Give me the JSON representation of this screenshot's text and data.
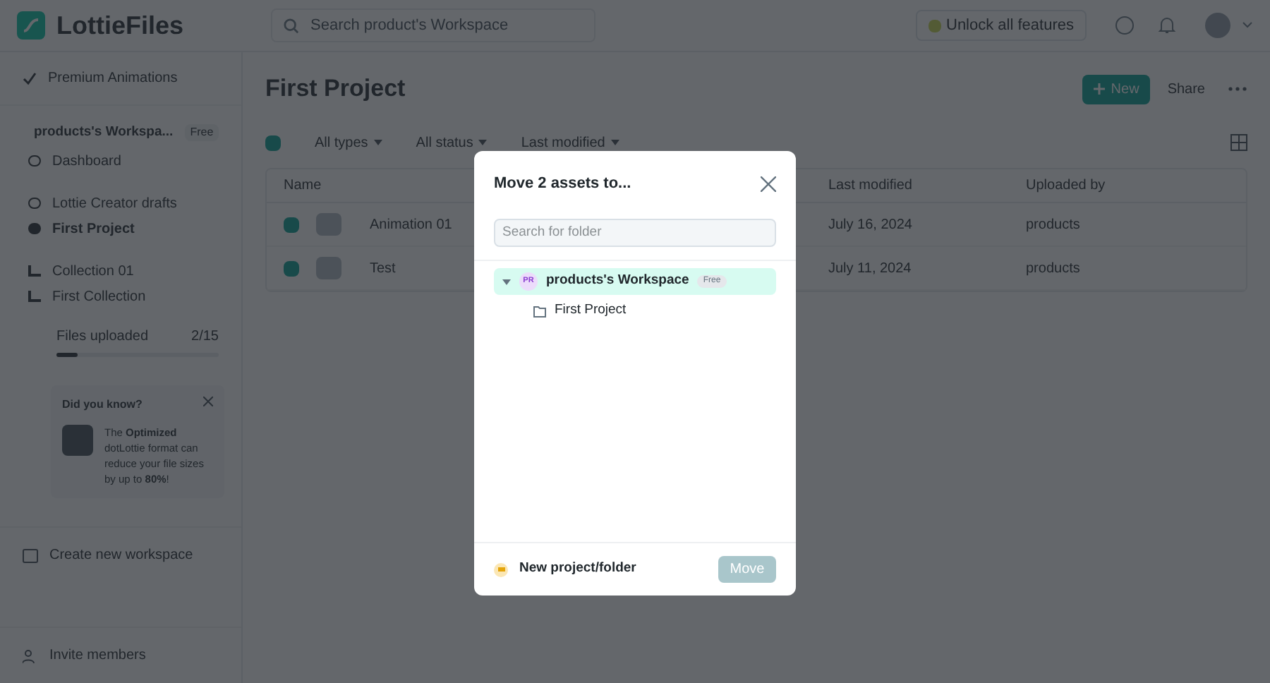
{
  "header": {
    "logo": "LottieFiles",
    "search_placeholder": "Search product's Workspace",
    "unlock_button": "Unlock all features"
  },
  "sidebar": {
    "premium": "Premium Animations",
    "workspace": {
      "name": "products's Workspa...",
      "badge": "Free"
    },
    "items": [
      {
        "label": "Dashboard",
        "kind": "dashboard",
        "selected": false
      },
      {
        "label": "Lottie Creator drafts",
        "kind": "drafts",
        "selected": false
      },
      {
        "label": "First Project",
        "kind": "project",
        "selected": true
      },
      {
        "label": "Collection 01",
        "kind": "collection",
        "selected": false
      },
      {
        "label": "First Collection",
        "kind": "collection",
        "selected": false
      }
    ],
    "files": {
      "label": "Files uploaded",
      "count": "2/15",
      "level": 0.13
    },
    "tip": {
      "title": "Did you know?",
      "text": "The **Optimized** dotLottie format can reduce your file sizes by up to **80%**!"
    },
    "create_workspace": "Create new workspace",
    "invite": "Invite members"
  },
  "main": {
    "title": "First Project",
    "new_button": "New",
    "share_button": "Share",
    "select_all": {
      "checked": true
    },
    "filters": [
      "All types",
      "All status",
      "Last modified"
    ],
    "columns": [
      "Name",
      "Last modified",
      "Uploaded by"
    ],
    "rows": [
      {
        "checked": true,
        "name": "Animation 01",
        "modified": "July 16, 2024",
        "uploaded_by": "products"
      },
      {
        "checked": true,
        "name": "Test",
        "modified": "July 11, 2024",
        "uploaded_by": "products"
      }
    ]
  },
  "modal": {
    "title": "Move 2 assets to...",
    "search_placeholder": "Search for folder",
    "tree": [
      {
        "label": "products's Workspace",
        "avatar": "PR",
        "badge": "Free",
        "expanded": true,
        "selected": true,
        "children": [
          {
            "label": "First Project",
            "selected": false
          }
        ]
      }
    ],
    "new_button": "New project/folder",
    "move_button": {
      "label": "Move",
      "disabled": true
    }
  }
}
